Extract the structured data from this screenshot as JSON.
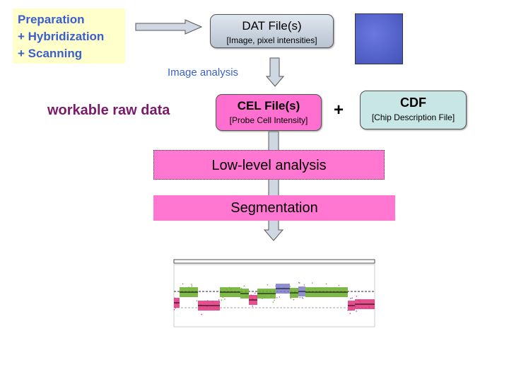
{
  "prep": {
    "lines": [
      "Preparation",
      "+ Hybridization",
      "+ Scanning"
    ]
  },
  "dat": {
    "title": "DAT File(s)",
    "subtitle": "[Image, pixel intensities]"
  },
  "image_analysis": "Image analysis",
  "raw_label": "workable raw data",
  "cel": {
    "title": "CEL File(s)",
    "subtitle": "[Probe Cell Intensity]"
  },
  "plus": "+",
  "cdf": {
    "title": "CDF",
    "subtitle": "[Chip Description File]"
  },
  "low_level": "Low-level analysis",
  "segmentation": "Segmentation",
  "colors": {
    "gain": "#7a7ac8",
    "normal": "#6aaa2a",
    "loss": "#e0307a",
    "accent_text": "#3a5fcd"
  }
}
